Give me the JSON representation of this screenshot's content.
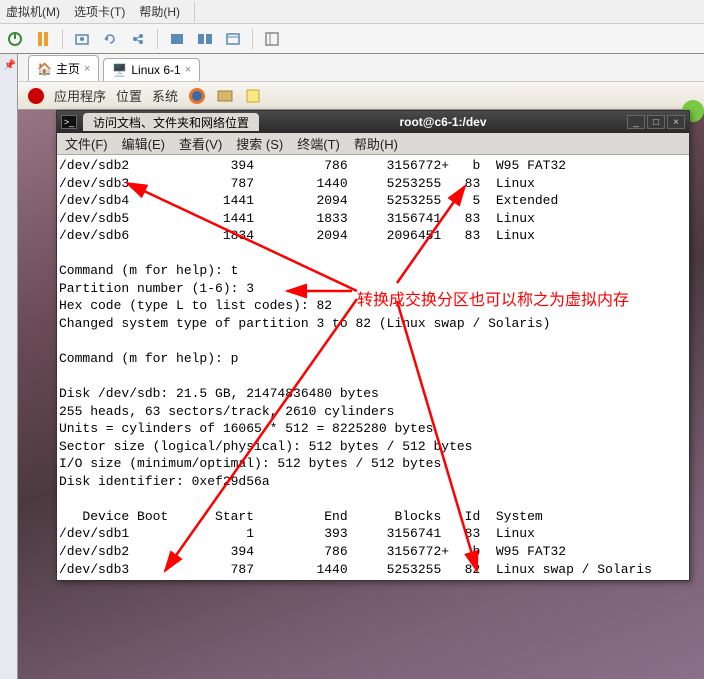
{
  "top_menu": {
    "vm": "虚拟机(M)",
    "tabs": "选项卡(T)",
    "help": "帮助(H)"
  },
  "vm_tabs": {
    "home": "主页",
    "linux": "Linux 6-1"
  },
  "gnome": {
    "apps": "应用程序",
    "places": "位置",
    "system": "系统"
  },
  "terminal": {
    "titlebar_tab": "访问文档、文件夹和网络位置",
    "title": "root@c6-1:/dev",
    "menu": {
      "file": "文件(F)",
      "edit": "编辑(E)",
      "view": "查看(V)",
      "search": "搜索 (S)",
      "terminal": "终端(T)",
      "help": "帮助(H)"
    }
  },
  "annotation": "转换成交换分区也可以称之为虚拟内存",
  "term_lines": [
    "/dev/sdb2             394         786     3156772+   b  W95 FAT32",
    "/dev/sdb3             787        1440     5253255   83  Linux",
    "/dev/sdb4            1441        2094     5253255    5  Extended",
    "/dev/sdb5            1441        1833     3156741   83  Linux",
    "/dev/sdb6            1834        2094     2096451   83  Linux",
    "",
    "Command (m for help): t",
    "Partition number (1-6): 3",
    "Hex code (type L to list codes): 82",
    "Changed system type of partition 3 to 82 (Linux swap / Solaris)",
    "",
    "Command (m for help): p",
    "",
    "Disk /dev/sdb: 21.5 GB, 21474836480 bytes",
    "255 heads, 63 sectors/track, 2610 cylinders",
    "Units = cylinders of 16065 * 512 = 8225280 bytes",
    "Sector size (logical/physical): 512 bytes / 512 bytes",
    "I/O size (minimum/optimal): 512 bytes / 512 bytes",
    "Disk identifier: 0xef29d56a",
    "",
    "   Device Boot      Start         End      Blocks   Id  System",
    "/dev/sdb1               1         393     3156741   83  Linux",
    "/dev/sdb2             394         786     3156772+   b  W95 FAT32",
    "/dev/sdb3             787        1440     5253255   82  Linux swap / Solaris"
  ]
}
